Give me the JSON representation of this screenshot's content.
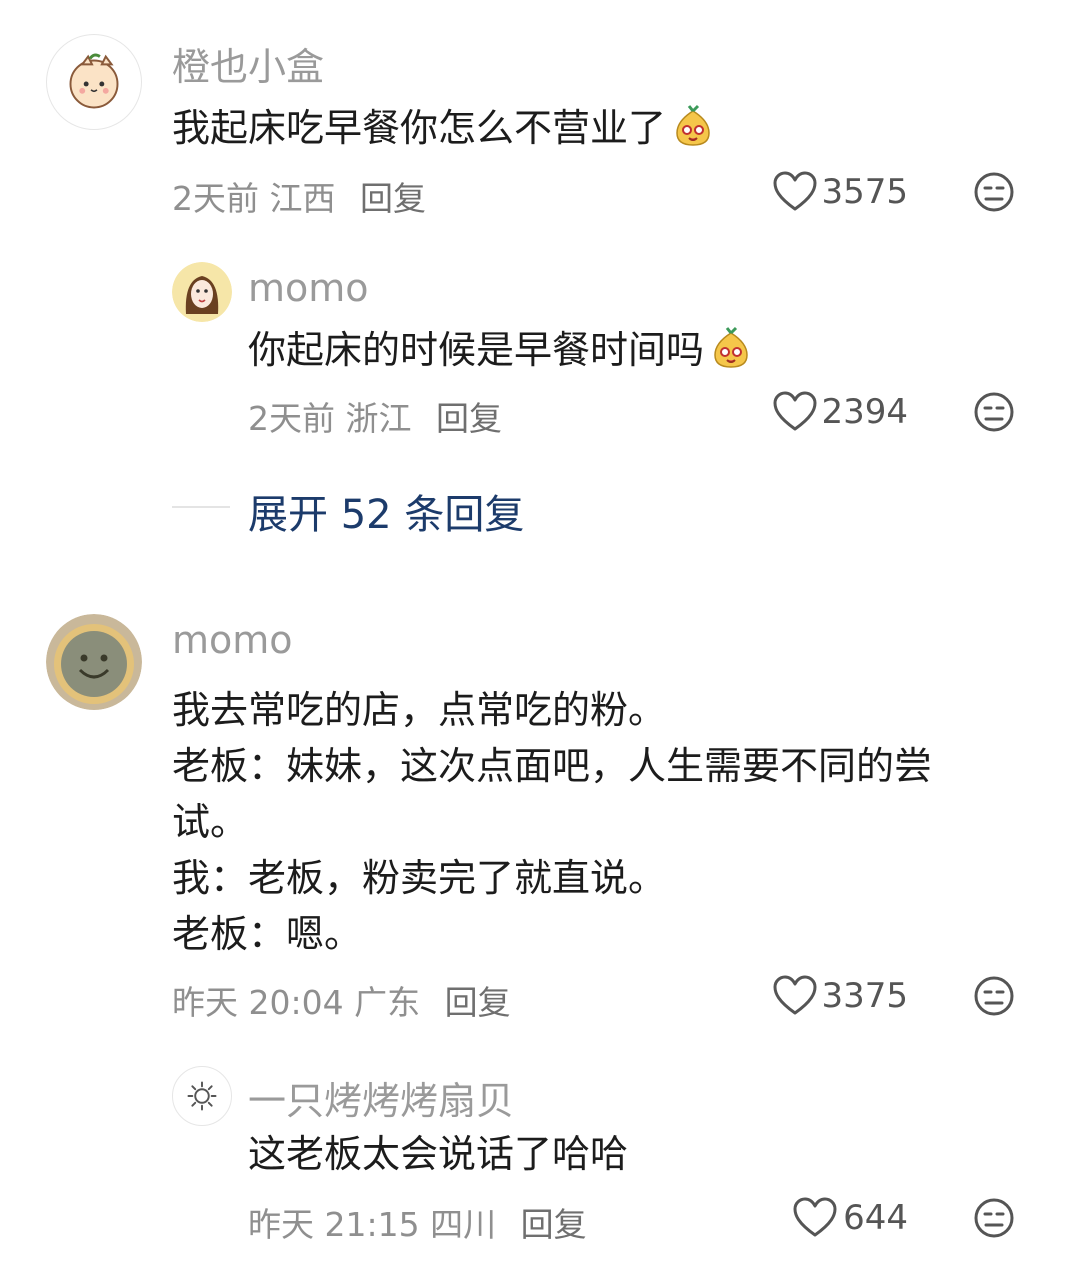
{
  "comments": [
    {
      "username": "橙也小盒",
      "text": "我起床吃早餐你怎么不营业了",
      "time": "2天前",
      "location": "江西",
      "reply_label": "回复",
      "likes": "3575",
      "avatar_icon": "orange-cat-avatar",
      "replies": [
        {
          "username": "momo",
          "text": "你起床的时候是早餐时间吗",
          "time": "2天前",
          "location": "浙江",
          "reply_label": "回复",
          "likes": "2394",
          "avatar_icon": "girl-avatar"
        }
      ],
      "expand_label": "展开 52 条回复"
    },
    {
      "username": "momo",
      "text_lines": [
        "我去常吃的店，点常吃的粉。",
        "老板：妹妹，这次点面吧，人生需要不同的尝",
        "试。",
        "我：老板，粉卖完了就直说。",
        "老板：嗯。"
      ],
      "time": "昨天 20:04",
      "location": "广东",
      "reply_label": "回复",
      "likes": "3375",
      "avatar_icon": "smiley-cake-avatar",
      "replies": [
        {
          "username": "一只烤烤烤扇贝",
          "text": "这老板太会说话了哈哈",
          "time": "昨天 21:15",
          "location": "四川",
          "reply_label": "回复",
          "likes": "644",
          "avatar_icon": "sun-avatar"
        }
      ]
    }
  ],
  "colors": {
    "username": "#9a9a9a",
    "text": "#1c1c1c",
    "meta": "#8f8f8f",
    "expand": "#1c3b6b"
  }
}
